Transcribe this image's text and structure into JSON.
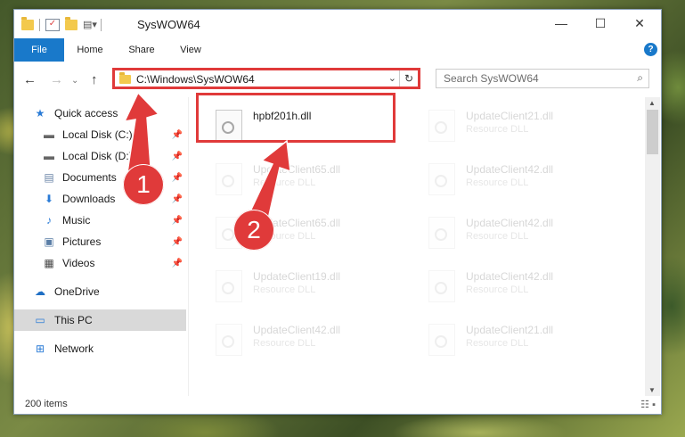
{
  "window": {
    "title": "SysWOW64"
  },
  "window_controls": {
    "minimize": "—",
    "maximize": "☐",
    "close": "✕"
  },
  "ribbon": {
    "tabs": [
      "File",
      "Home",
      "Share",
      "View"
    ],
    "help": "?"
  },
  "address_bar": {
    "path": "C:\\Windows\\SysWOW64"
  },
  "search": {
    "placeholder": "Search SysWOW64"
  },
  "sidebar": {
    "items": [
      {
        "label": "Quick access",
        "icon": "star-icon"
      },
      {
        "label": "Local Disk (C:)",
        "icon": "drive-icon"
      },
      {
        "label": "Local Disk (D:)",
        "icon": "drive-icon"
      },
      {
        "label": "Documents",
        "icon": "documents-icon"
      },
      {
        "label": "Downloads",
        "icon": "download-icon"
      },
      {
        "label": "Music",
        "icon": "music-icon"
      },
      {
        "label": "Pictures",
        "icon": "pictures-icon"
      },
      {
        "label": "Videos",
        "icon": "videos-icon"
      },
      {
        "label": "OneDrive",
        "icon": "cloud-icon"
      },
      {
        "label": "This PC",
        "icon": "computer-icon"
      },
      {
        "label": "Network",
        "icon": "network-icon"
      }
    ]
  },
  "files": [
    {
      "name": "hpbf201h.dll",
      "desc": ""
    },
    {
      "name": "UpdateClient21.dll",
      "desc": "Resource DLL"
    },
    {
      "name": "UpdateClient65.dll",
      "desc": "Resource DLL"
    },
    {
      "name": "UpdateClient42.dll",
      "desc": "Resource DLL"
    },
    {
      "name": "UpdateClient65.dll",
      "desc": "Resource DLL"
    },
    {
      "name": "UpdateClient42.dll",
      "desc": "Resource DLL"
    },
    {
      "name": "UpdateClient19.dll",
      "desc": "Resource DLL"
    },
    {
      "name": "UpdateClient42.dll",
      "desc": "Resource DLL"
    },
    {
      "name": "UpdateClient42.dll",
      "desc": "Resource DLL"
    },
    {
      "name": "UpdateClient21.dll",
      "desc": "Resource DLL"
    }
  ],
  "status": {
    "item_count": "200 items"
  },
  "annotations": {
    "step1": "1",
    "step2": "2"
  },
  "colors": {
    "accent": "#1979ca",
    "highlight": "#e03a3a"
  }
}
